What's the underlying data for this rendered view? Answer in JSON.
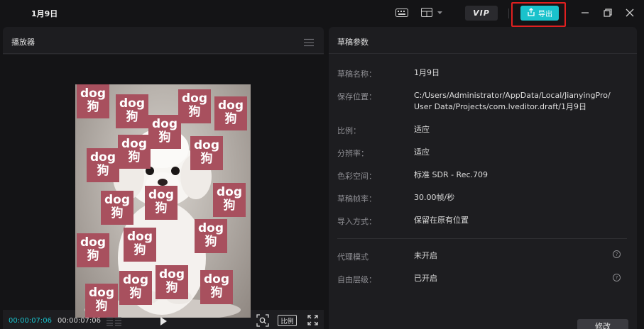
{
  "app": {
    "title": "1月9日"
  },
  "toolbar": {
    "vip_label": "VIP",
    "export_label": "导出"
  },
  "player": {
    "title": "播放器",
    "time_current": "00:00:07:06",
    "time_total": "00:00:07:06",
    "ratio_label": "比例",
    "sticker_line1": "dog",
    "sticker_line2": "狗"
  },
  "draft": {
    "title": "草稿参数",
    "params": [
      {
        "label": "草稿名称：",
        "value": "1月9日"
      },
      {
        "label": "保存位置：",
        "value_line1": "C:/Users/Administrator/AppData/Local/JianyingPro/",
        "value_line2": "User Data/Projects/com.lveditor.draft/1月9日"
      },
      {
        "label": "比例：",
        "value": "适应"
      },
      {
        "label": "分辨率：",
        "value": "适应"
      },
      {
        "label": "色彩空间：",
        "value": "标准 SDR - Rec.709"
      },
      {
        "label": "草稿帧率：",
        "value": "30.00帧/秒"
      },
      {
        "label": "导入方式：",
        "value": "保留在原有位置"
      },
      {
        "label": "代理模式",
        "value": "未开启"
      },
      {
        "label": "自由层级：",
        "value": "已开启"
      }
    ],
    "modify_label": "修改"
  },
  "colors": {
    "accent": "#19c2cc",
    "highlight_frame": "#e02020",
    "sticker": "#a8505e"
  }
}
